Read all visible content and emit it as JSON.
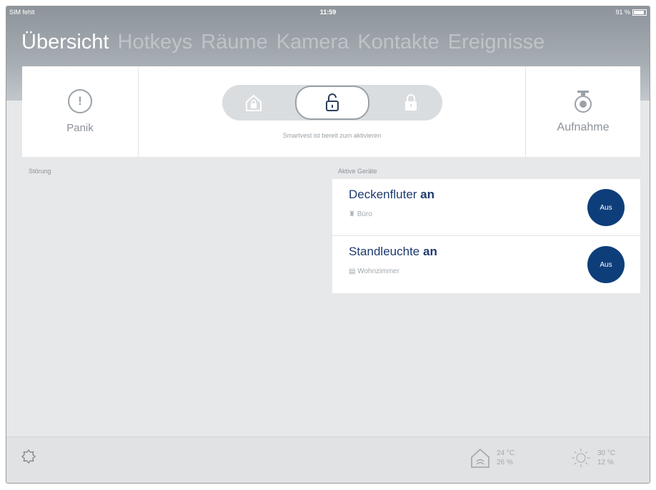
{
  "status_bar": {
    "carrier": "SIM fehlt",
    "time": "11:59",
    "battery": "91 %"
  },
  "tabs": [
    {
      "label": "Übersicht",
      "active": true
    },
    {
      "label": "Hotkeys",
      "active": false
    },
    {
      "label": "Räume",
      "active": false
    },
    {
      "label": "Kamera",
      "active": false
    },
    {
      "label": "Kontakte",
      "active": false
    },
    {
      "label": "Ereignisse",
      "active": false
    }
  ],
  "panik": {
    "label": "Panik",
    "icon": "exclamation-icon"
  },
  "mode_toggle": {
    "options": [
      "home-lock-icon",
      "unlocked-icon",
      "locked-icon"
    ],
    "selected": "unlocked-icon",
    "status_text": "Smartvest ist bereit zum aktivieren"
  },
  "aufnahme": {
    "label": "Aufnahme",
    "icon": "camera-icon"
  },
  "stoerung": {
    "label": "Störung"
  },
  "active_devices": {
    "label": "Aktive Geräte",
    "items": [
      {
        "name": "Deckenfluter",
        "state": "an",
        "room": "Büro",
        "button": "Aus"
      },
      {
        "name": "Standleuchte",
        "state": "an",
        "room": "Wohnzimmer",
        "button": "Aus"
      }
    ]
  },
  "bottom_bar": {
    "indoor": {
      "temp": "24 °C",
      "humidity": "26 %"
    },
    "outdoor": {
      "temp": "30 °C",
      "humidity": "12 %"
    }
  },
  "colors": {
    "accent": "#0e3e7a",
    "header": "#a6adb3",
    "background": "#e6e8ea"
  }
}
